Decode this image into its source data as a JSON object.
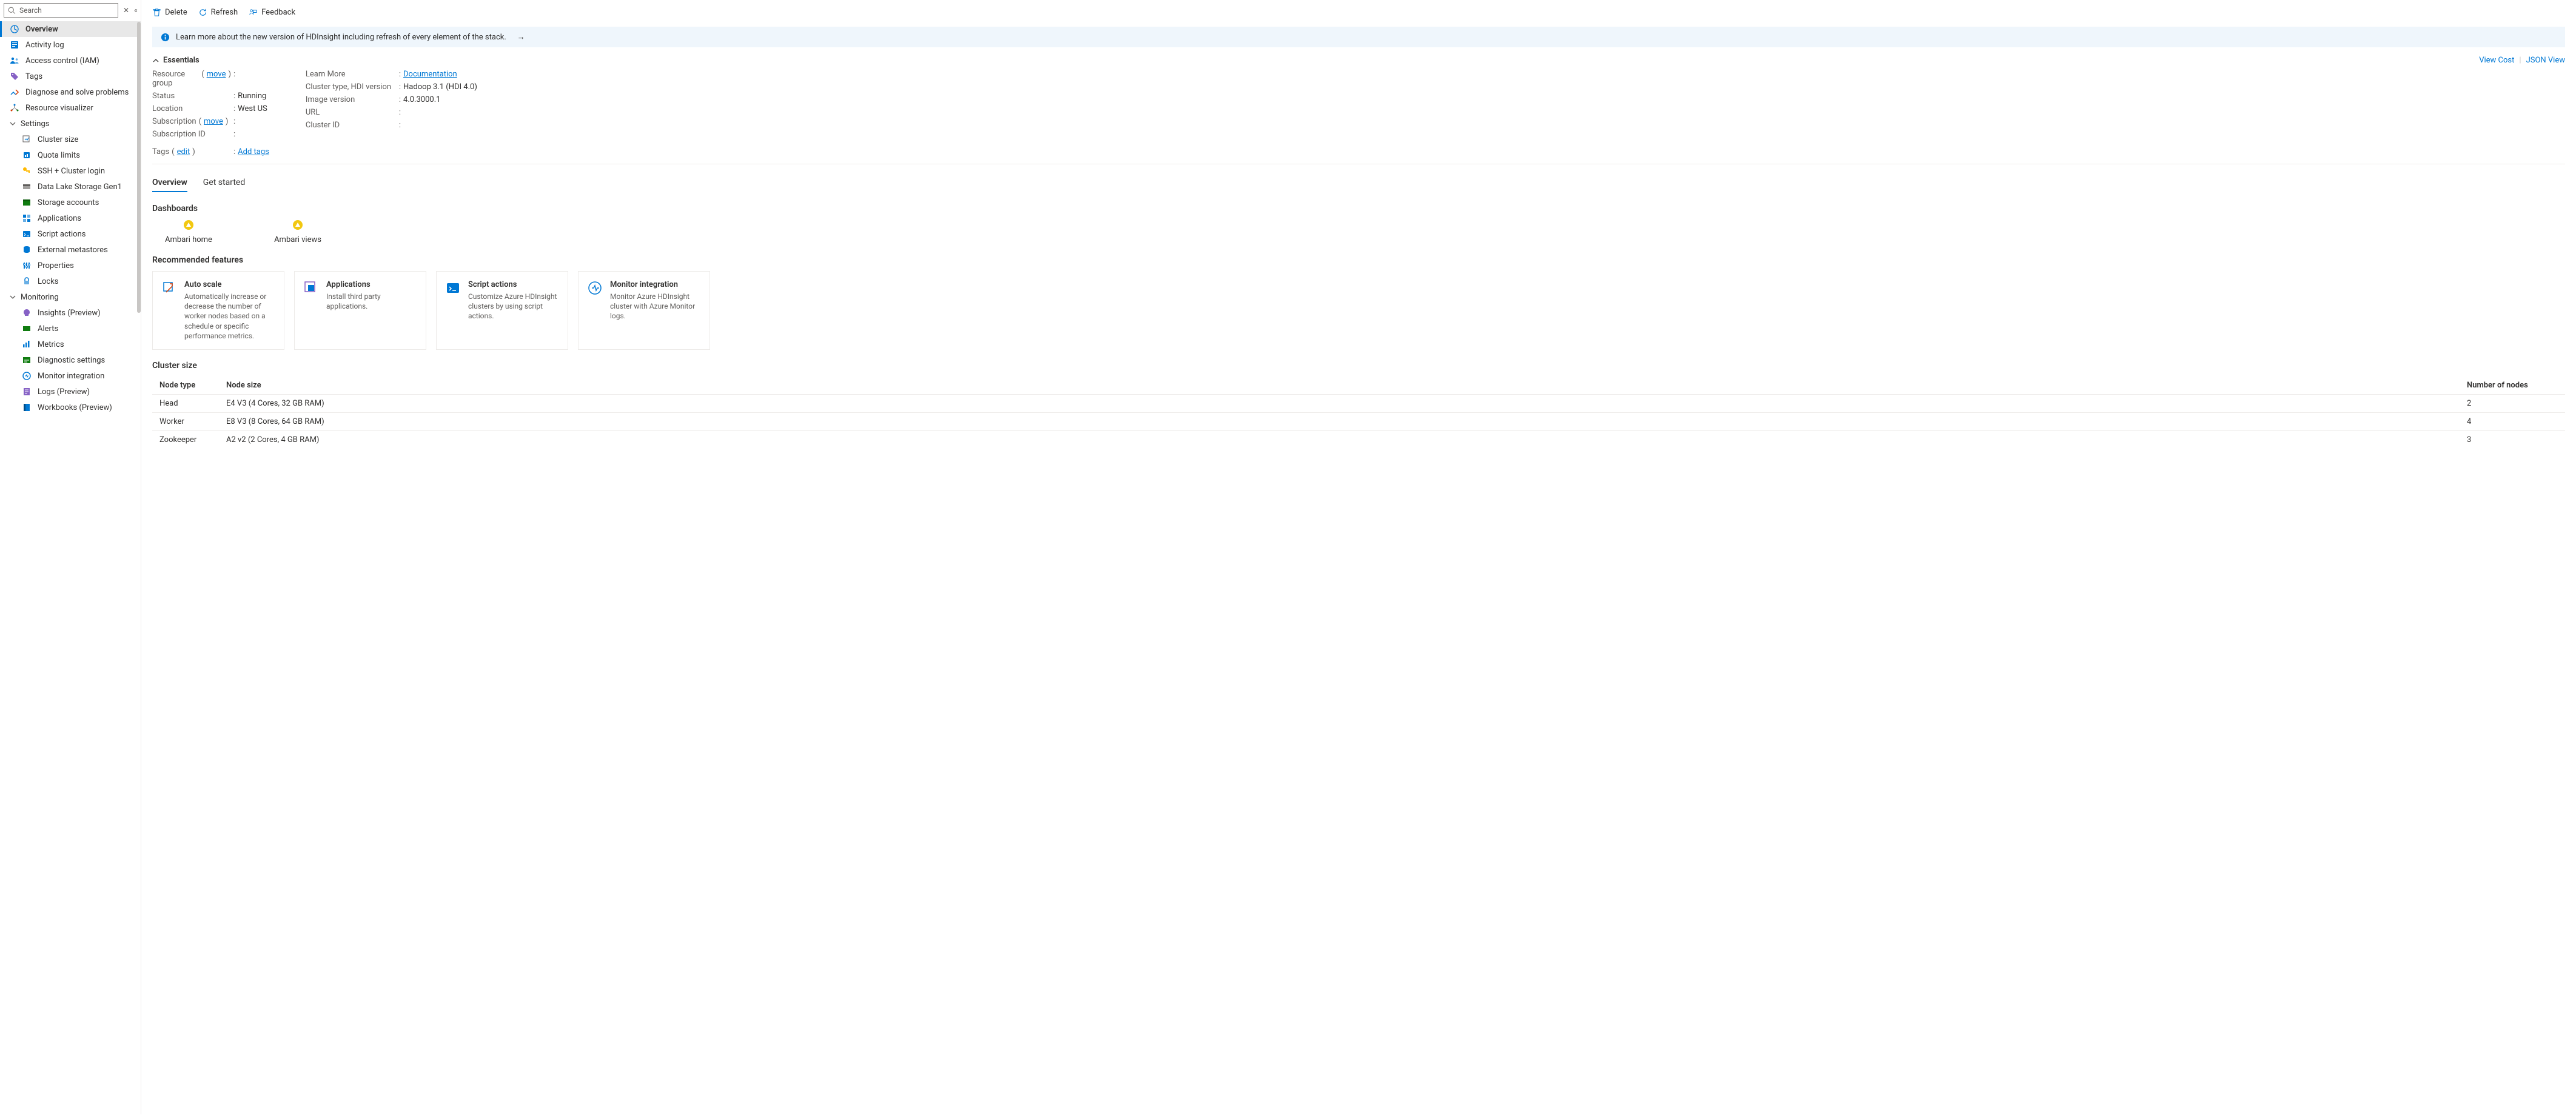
{
  "search": {
    "placeholder": "Search"
  },
  "sidebar": {
    "top": [
      {
        "label": "Overview"
      },
      {
        "label": "Activity log"
      },
      {
        "label": "Access control (IAM)"
      },
      {
        "label": "Tags"
      },
      {
        "label": "Diagnose and solve problems"
      },
      {
        "label": "Resource visualizer"
      }
    ],
    "settings": {
      "label": "Settings",
      "items": [
        {
          "label": "Cluster size"
        },
        {
          "label": "Quota limits"
        },
        {
          "label": "SSH + Cluster login"
        },
        {
          "label": "Data Lake Storage Gen1"
        },
        {
          "label": "Storage accounts"
        },
        {
          "label": "Applications"
        },
        {
          "label": "Script actions"
        },
        {
          "label": "External metastores"
        },
        {
          "label": "Properties"
        },
        {
          "label": "Locks"
        }
      ]
    },
    "monitoring": {
      "label": "Monitoring",
      "items": [
        {
          "label": "Insights (Preview)"
        },
        {
          "label": "Alerts"
        },
        {
          "label": "Metrics"
        },
        {
          "label": "Diagnostic settings"
        },
        {
          "label": "Monitor integration"
        },
        {
          "label": "Logs (Preview)"
        },
        {
          "label": "Workbooks (Preview)"
        }
      ]
    }
  },
  "toolbar": {
    "delete": "Delete",
    "refresh": "Refresh",
    "feedback": "Feedback"
  },
  "banner": {
    "text": "Learn more about the new version of HDInsight including refresh of every element of the stack."
  },
  "essentials": {
    "title": "Essentials",
    "viewCost": "View Cost",
    "jsonView": "JSON View",
    "left": {
      "rgLabel": "Resource group",
      "rgMove": "move",
      "statusLabel": "Status",
      "statusValue": "Running",
      "locationLabel": "Location",
      "locationValue": "West US",
      "subLabel": "Subscription",
      "subMove": "move",
      "subIdLabel": "Subscription ID",
      "tagsLabel": "Tags",
      "tagsEdit": "edit",
      "tagsValue": "Add tags"
    },
    "right": {
      "learnLabel": "Learn More",
      "learnValue": "Documentation",
      "typeLabel": "Cluster type, HDI version",
      "typeValue": "Hadoop 3.1 (HDI 4.0)",
      "imgLabel": "Image version",
      "imgValue": "4.0.3000.1",
      "urlLabel": "URL",
      "cidLabel": "Cluster ID"
    }
  },
  "tabs": {
    "overview": "Overview",
    "getStarted": "Get started"
  },
  "dashboards": {
    "title": "Dashboards",
    "ambariHome": "Ambari home",
    "ambariViews": "Ambari views"
  },
  "recommended": {
    "title": "Recommended features",
    "cards": [
      {
        "title": "Auto scale",
        "desc": "Automatically increase or decrease the number of worker nodes based on a schedule or specific performance metrics."
      },
      {
        "title": "Applications",
        "desc": "Install third party applications."
      },
      {
        "title": "Script actions",
        "desc": "Customize Azure HDInsight clusters by using script actions."
      },
      {
        "title": "Monitor integration",
        "desc": "Monitor Azure HDInsight cluster with Azure Monitor logs."
      }
    ]
  },
  "clusterSize": {
    "title": "Cluster size",
    "headers": {
      "nodeType": "Node type",
      "nodeSize": "Node size",
      "count": "Number of nodes"
    },
    "rows": [
      {
        "type": "Head",
        "size": "E4 V3 (4 Cores, 32 GB RAM)",
        "count": "2"
      },
      {
        "type": "Worker",
        "size": "E8 V3 (8 Cores, 64 GB RAM)",
        "count": "4"
      },
      {
        "type": "Zookeeper",
        "size": "A2 v2 (2 Cores, 4 GB RAM)",
        "count": "3"
      }
    ]
  }
}
